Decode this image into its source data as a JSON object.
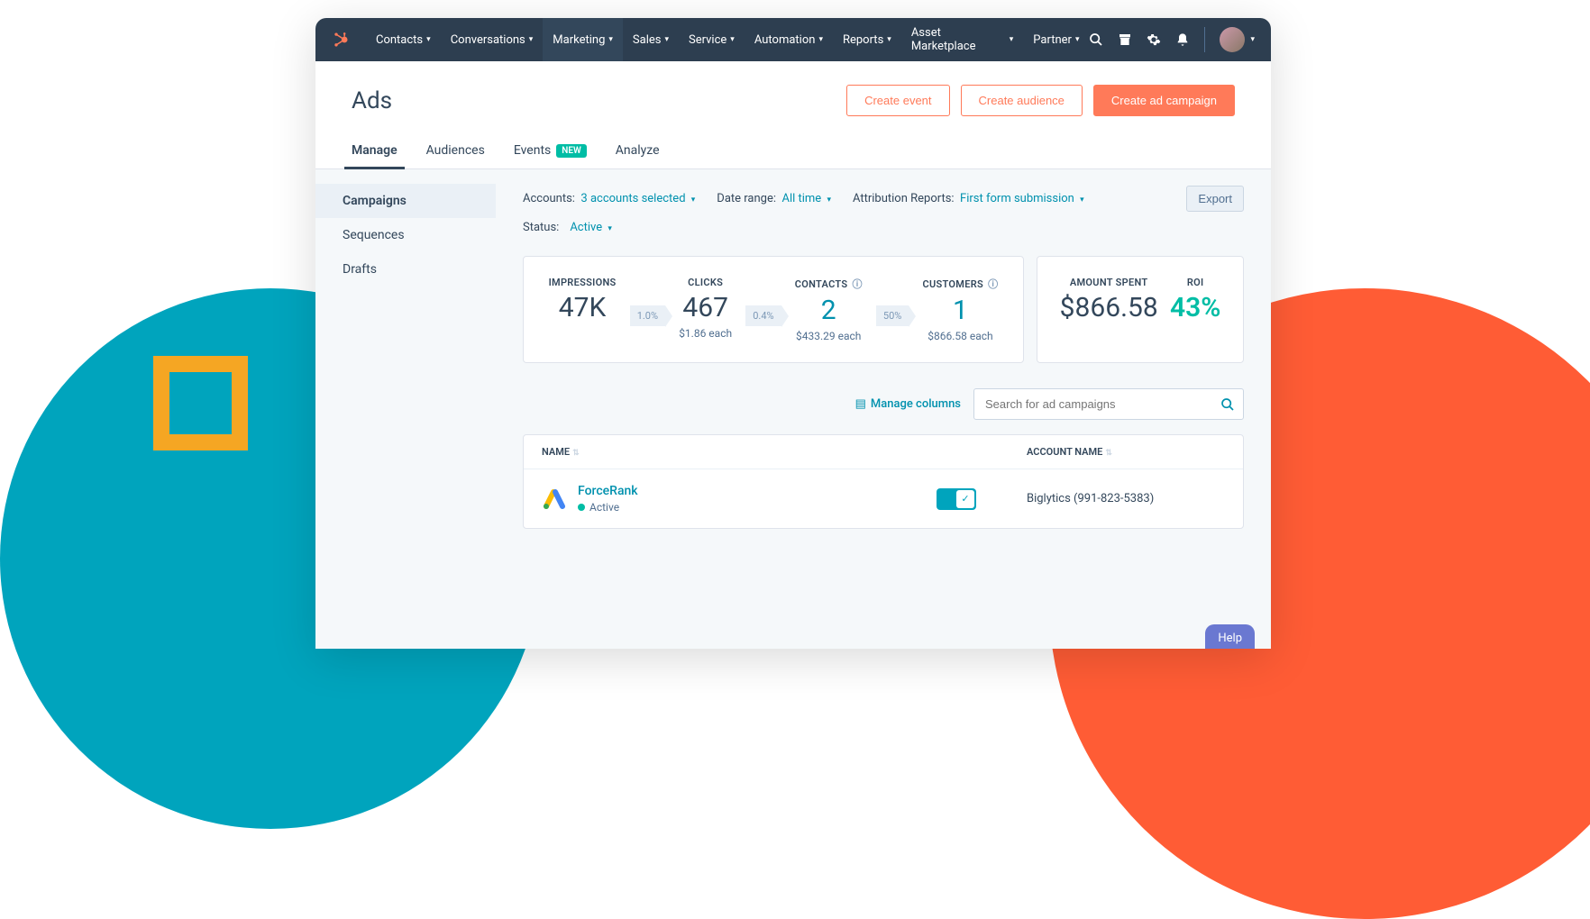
{
  "nav": {
    "items": [
      "Contacts",
      "Conversations",
      "Marketing",
      "Sales",
      "Service",
      "Automation",
      "Reports",
      "Asset Marketplace",
      "Partner"
    ],
    "active_index": 2
  },
  "page": {
    "title": "Ads",
    "actions": {
      "create_event": "Create event",
      "create_audience": "Create audience",
      "create_campaign": "Create ad campaign"
    }
  },
  "tabs": [
    {
      "label": "Manage",
      "active": true
    },
    {
      "label": "Audiences"
    },
    {
      "label": "Events",
      "badge": "NEW"
    },
    {
      "label": "Analyze"
    }
  ],
  "sidebar": {
    "items": [
      {
        "label": "Campaigns",
        "active": true
      },
      {
        "label": "Sequences"
      },
      {
        "label": "Drafts"
      }
    ]
  },
  "filters": {
    "accounts_label": "Accounts:",
    "accounts_value": "3 accounts selected",
    "daterange_label": "Date range:",
    "daterange_value": "All time",
    "attribution_label": "Attribution Reports:",
    "attribution_value": "First form submission",
    "status_label": "Status:",
    "status_value": "Active",
    "export": "Export"
  },
  "funnel": {
    "impressions": {
      "label": "IMPRESSIONS",
      "value": "47K"
    },
    "rate1": "1.0%",
    "clicks": {
      "label": "CLICKS",
      "value": "467",
      "sub": "$1.86 each"
    },
    "rate2": "0.4%",
    "contacts": {
      "label": "CONTACTS",
      "value": "2",
      "sub": "$433.29 each"
    },
    "rate3": "50%",
    "customers": {
      "label": "CUSTOMERS",
      "value": "1",
      "sub": "$866.58 each"
    }
  },
  "summary": {
    "spent_label": "AMOUNT SPENT",
    "spent_value": "$866.58",
    "roi_label": "ROI",
    "roi_value": "43%"
  },
  "table_controls": {
    "manage_columns": "Manage columns",
    "search_placeholder": "Search for ad campaigns"
  },
  "table": {
    "columns": {
      "name": "NAME",
      "account": "ACCOUNT NAME"
    },
    "rows": [
      {
        "name": "ForceRank",
        "status": "Active",
        "account": "Biglytics (991-823-5383)",
        "enabled": true
      }
    ]
  },
  "help": "Help"
}
